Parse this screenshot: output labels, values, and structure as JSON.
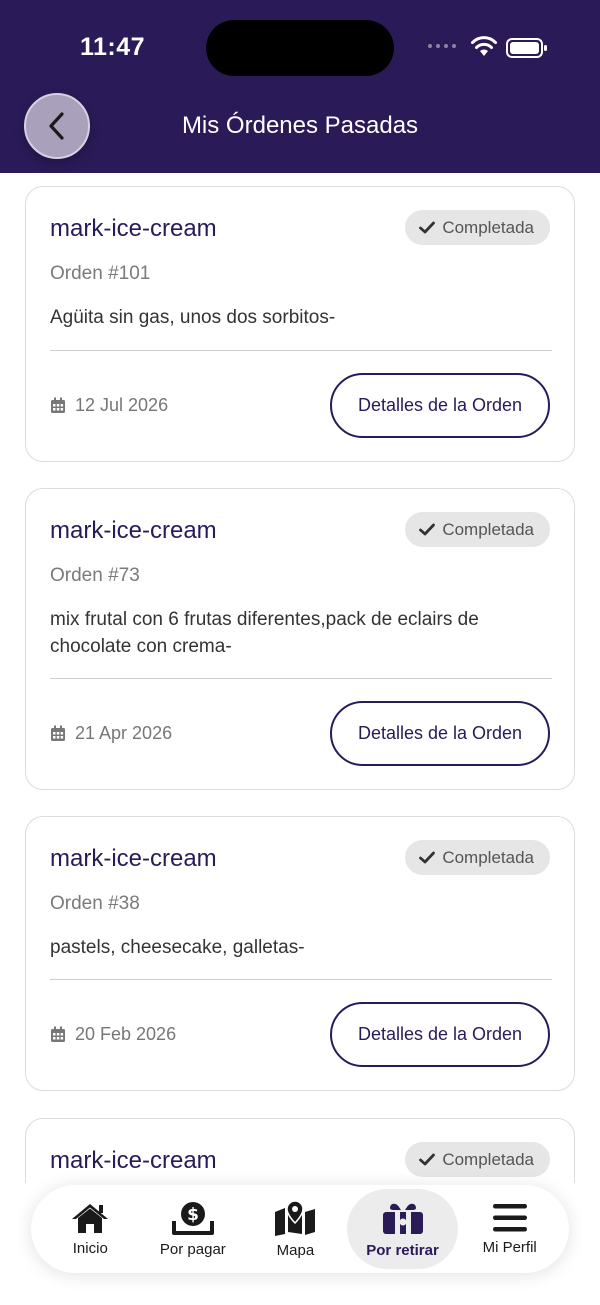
{
  "status_bar": {
    "time": "11:47"
  },
  "header": {
    "title": "Mis Órdenes Pasadas"
  },
  "orders": [
    {
      "store": "mark-ice-cream",
      "status": "Completada",
      "order_number": "Orden #101",
      "items": "Agüita sin gas, unos dos sorbitos-",
      "date": "12 Jul 2026",
      "button": "Detalles de la Orden"
    },
    {
      "store": "mark-ice-cream",
      "status": "Completada",
      "order_number": "Orden #73",
      "items": "mix frutal con 6 frutas diferentes,pack de eclairs de chocolate con crema-",
      "date": "21 Apr 2026",
      "button": "Detalles de la Orden"
    },
    {
      "store": "mark-ice-cream",
      "status": "Completada",
      "order_number": "Orden #38",
      "items": "pastels, cheesecake, galletas-",
      "date": "20 Feb 2026",
      "button": "Detalles de la Orden"
    },
    {
      "store": "mark-ice-cream",
      "status": "Completada"
    }
  ],
  "tabs": [
    {
      "label": "Inicio",
      "icon": "home-icon"
    },
    {
      "label": "Por pagar",
      "icon": "money-bag-icon"
    },
    {
      "label": "Mapa",
      "icon": "map-icon"
    },
    {
      "label": "Por retirar",
      "icon": "gift-icon",
      "active": true
    },
    {
      "label": "Mi Perfil",
      "icon": "menu-icon"
    }
  ],
  "colors": {
    "brand": "#2a1a58",
    "badge_bg": "#e6e6e6",
    "card_border": "#dcdcdc"
  }
}
